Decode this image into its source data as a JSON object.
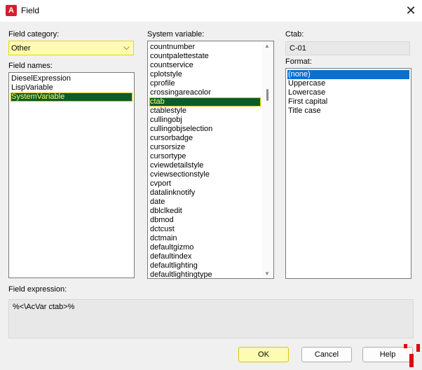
{
  "window": {
    "app_icon_letter": "A",
    "title": "Field",
    "close_glyph": "✕"
  },
  "field_category": {
    "label": "Field category:",
    "value": "Other"
  },
  "field_names": {
    "label": "Field names:",
    "items": [
      "DieselExpression",
      "LispVariable",
      "SystemVariable"
    ],
    "selected": "SystemVariable"
  },
  "system_variable": {
    "label": "System variable:",
    "items": [
      "countnumber",
      "countpalettestate",
      "countservice",
      "cplotstyle",
      "cprofile",
      "crossingareacolor",
      "ctab",
      "ctablestyle",
      "cullingobj",
      "cullingobjselection",
      "cursorbadge",
      "cursorsize",
      "cursortype",
      "cviewdetailstyle",
      "cviewsectionstyle",
      "cvport",
      "datalinknotify",
      "date",
      "dblclkedit",
      "dbmod",
      "dctcust",
      "dctmain",
      "defaultgizmo",
      "defaultindex",
      "defaultlighting",
      "defaultlightingtype"
    ],
    "selected": "ctab"
  },
  "ctab": {
    "label": "Ctab:",
    "value": "C-01"
  },
  "format": {
    "label": "Format:",
    "items": [
      "(none)",
      "Uppercase",
      "Lowercase",
      "First capital",
      "Title case"
    ],
    "selected": "(none)"
  },
  "field_expression": {
    "label": "Field expression:",
    "value": "%<\\AcVar ctab>%"
  },
  "buttons": {
    "ok": "OK",
    "cancel": "Cancel",
    "help": "Help"
  },
  "icons": {
    "dropdown": "chevron-down-icon",
    "scroll_up": "scroll-up-icon",
    "scroll_down": "scroll-down-icon"
  },
  "colors": {
    "highlight_yellow": "#fffbb0",
    "selection_green": "#0c5b2d",
    "selection_blue": "#0a6fd1",
    "app_red": "#d4202e"
  }
}
